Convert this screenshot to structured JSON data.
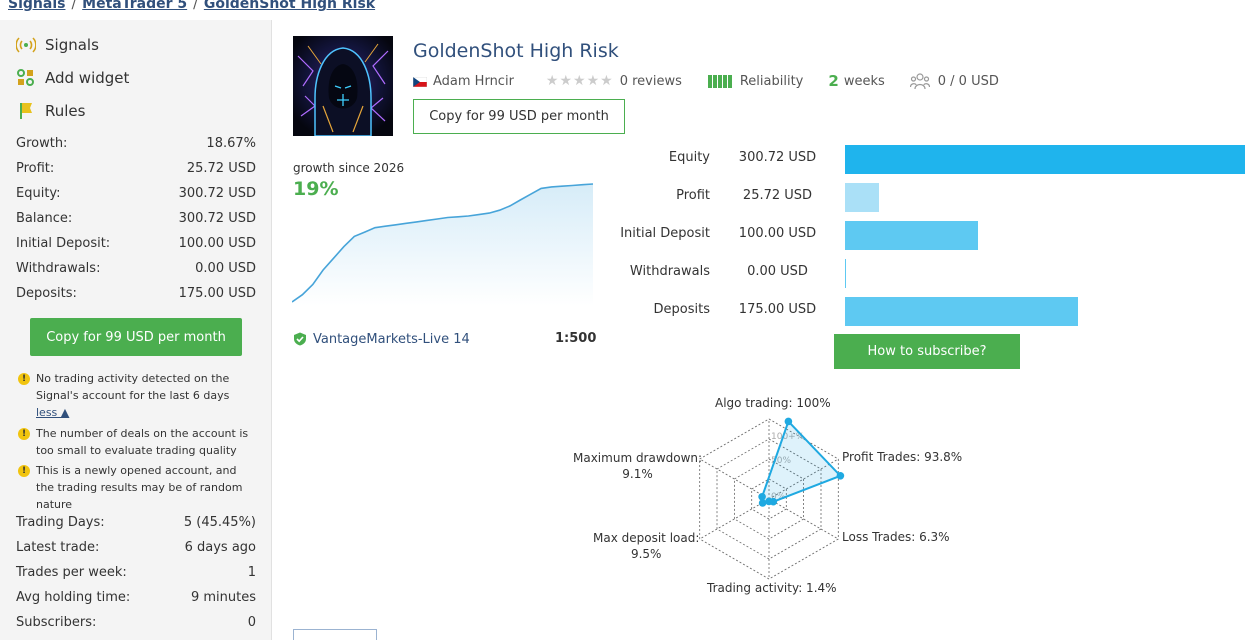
{
  "breadcrumb": [
    "Signals",
    "MetaTrader 5",
    "GoldenShot High Risk"
  ],
  "breadcrumb_sep": "/",
  "sidebar": {
    "nav": [
      {
        "label": "Signals",
        "icon": "signal-antenna-icon"
      },
      {
        "label": "Add widget",
        "icon": "widget-grid-icon"
      },
      {
        "label": "Rules",
        "icon": "flag-icon"
      }
    ],
    "stats": [
      {
        "label": "Growth:",
        "value": "18.67%"
      },
      {
        "label": "Profit:",
        "value": "25.72 USD"
      },
      {
        "label": "Equity:",
        "value": "300.72 USD"
      },
      {
        "label": "Balance:",
        "value": "300.72 USD"
      },
      {
        "label": "Initial Deposit:",
        "value": "100.00 USD"
      },
      {
        "label": "Withdrawals:",
        "value": "0.00 USD"
      },
      {
        "label": "Deposits:",
        "value": "175.00 USD"
      }
    ],
    "copy_button": "Copy for 99 USD per month",
    "warnings": [
      {
        "text": "No trading activity detected on the Signal's account for the last 6 days",
        "toggle": "less ▲"
      },
      {
        "text": "The number of deals on the account is too small to evaluate trading quality"
      },
      {
        "text": "This is a newly opened account, and the trading results may be of random nature"
      }
    ],
    "warning_icon": "!",
    "trading_stats": [
      {
        "label": "Trading Days:",
        "value": "5 (45.45%)"
      },
      {
        "label": "Latest trade:",
        "value": "6 days ago"
      },
      {
        "label": "Trades per week:",
        "value": "1"
      },
      {
        "label": "Avg holding time:",
        "value": "9 minutes"
      },
      {
        "label": "Subscribers:",
        "value": "0"
      }
    ]
  },
  "signal": {
    "title": "GoldenShot High Risk",
    "author": "Adam Hrncir",
    "stars": "★★★★★",
    "reviews": "0 reviews",
    "reliability_label": "Reliability",
    "weeks_num": "2",
    "weeks_label": "weeks",
    "subscribers": "0 / 0 USD",
    "copy_button": "Copy for 99 USD per month"
  },
  "growth": {
    "label": "growth since 2026",
    "value": "19%",
    "series": [
      0,
      5,
      12,
      22,
      30,
      38,
      45,
      48,
      51,
      52,
      53,
      54,
      55,
      56,
      57,
      58,
      58.5,
      59,
      60,
      61,
      63,
      66,
      70,
      74,
      78,
      79,
      79.5,
      80,
      80.5,
      81
    ]
  },
  "broker": "VantageMarkets-Live 14",
  "leverage": "1:500",
  "bars": [
    {
      "label": "Equity",
      "value": "300.72 USD",
      "amount": 300.72,
      "color": "#1fb4ed"
    },
    {
      "label": "Profit",
      "value": "25.72 USD",
      "amount": 25.72,
      "color": "#aae0f7"
    },
    {
      "label": "Initial Deposit",
      "value": "100.00 USD",
      "amount": 100.0,
      "color": "#5ec9f2"
    },
    {
      "label": "Withdrawals",
      "value": "0.00 USD",
      "amount": 0.0,
      "color": "#5ec9f2"
    },
    {
      "label": "Deposits",
      "value": "175.00 USD",
      "amount": 175.0,
      "color": "#5ec9f2"
    }
  ],
  "bars_max": 300.72,
  "howto_button": "How to subscribe?",
  "radar": {
    "labels": [
      {
        "key": "algo",
        "text": "Algo trading: 100%"
      },
      {
        "key": "profit",
        "text": "Profit Trades: 93.8%"
      },
      {
        "key": "loss",
        "text": "Loss Trades: 6.3%"
      },
      {
        "key": "activity",
        "text": "Trading activity: 1.4%"
      },
      {
        "key": "deposit_load",
        "text": "Max deposit load:\n9.5%"
      },
      {
        "key": "drawdown",
        "text": "Maximum drawdown:\n9.1%"
      }
    ],
    "values": [
      100,
      93.8,
      6.3,
      1.4,
      9.5,
      9.1
    ],
    "scale_labels": [
      "100+%",
      "50%",
      "0%"
    ],
    "accent": "#1fa9e1"
  }
}
